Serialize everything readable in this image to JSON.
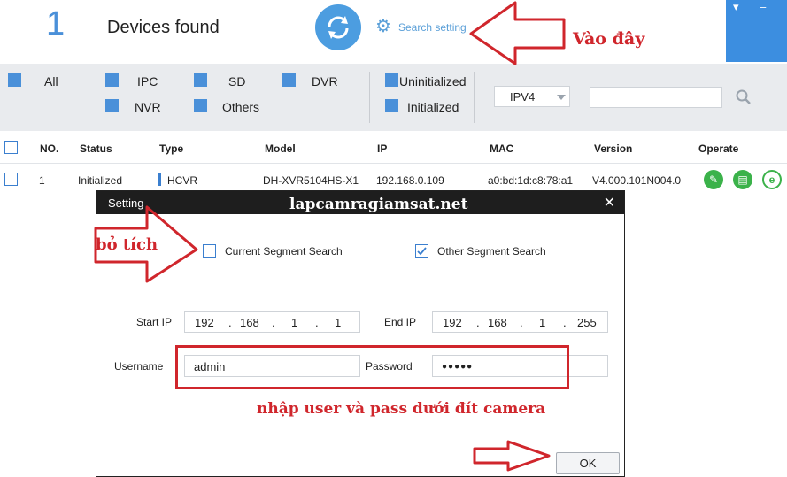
{
  "header": {
    "device_count": "1",
    "devices_found_label": "Devices found",
    "search_setting_label": "Search setting",
    "window_controls": [
      "▾",
      "–"
    ]
  },
  "filters": {
    "categories": [
      {
        "label": "All",
        "checked": true
      },
      {
        "label": "IPC",
        "checked": true
      },
      {
        "label": "SD",
        "checked": true
      },
      {
        "label": "DVR",
        "checked": true
      },
      {
        "label": "NVR",
        "checked": true
      },
      {
        "label": "Others",
        "checked": true
      }
    ],
    "status": [
      {
        "label": "Uninitialized",
        "checked": true
      },
      {
        "label": "Initialized",
        "checked": true
      }
    ],
    "ip_version": "IPV4",
    "search_value": ""
  },
  "table": {
    "columns": [
      "NO.",
      "Status",
      "Type",
      "Model",
      "IP",
      "MAC",
      "Version",
      "Operate"
    ],
    "rows": [
      {
        "no": "1",
        "status": "Initialized",
        "type": "HCVR",
        "model": "DH-XVR5104HS-X1",
        "ip": "192.168.0.109",
        "mac": "a0:bd:1d:c8:78:a1",
        "version": "V4.000.101N004.0"
      }
    ]
  },
  "dialog": {
    "title": "Setting",
    "watermark": "lapcamragiamsat.net",
    "current_segment_label": "Current Segment Search",
    "current_segment_checked": false,
    "other_segment_label": "Other Segment Search",
    "other_segment_checked": true,
    "start_ip_label": "Start IP",
    "start_ip": [
      "192",
      "168",
      "1",
      "1"
    ],
    "end_ip_label": "End IP",
    "end_ip": [
      "192",
      "168",
      "1",
      "255"
    ],
    "username_label": "Username",
    "username_value": "admin",
    "password_label": "Password",
    "password_value": "●●●●●",
    "ok_label": "OK",
    "close_glyph": "✕"
  },
  "annotations": {
    "vao_day": "Vào đây",
    "bo_tich": "bỏ tích",
    "nhap_user": "nhập user và pass dưới đít camera",
    "color": "#d0262c"
  }
}
